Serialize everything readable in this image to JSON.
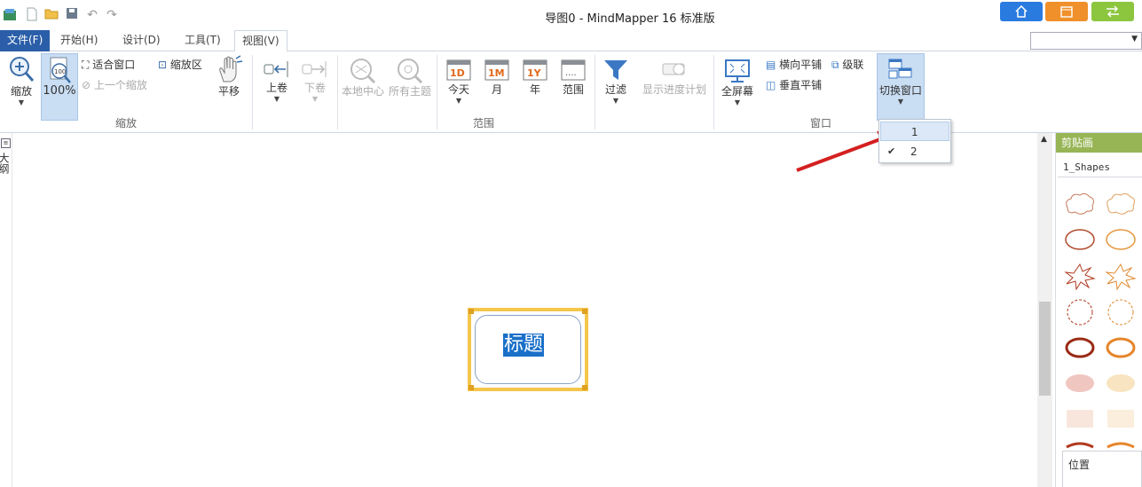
{
  "window": {
    "title": "导图0 - MindMapper 16 标准版"
  },
  "colors": {
    "win_home": "#2a7be0",
    "win_cal": "#f0902a",
    "win_swap": "#8cc63f",
    "accent": "#2a5ea8",
    "selection": "#1a70c9",
    "topic_border": "#f5c64a",
    "panel_header": "#97b555"
  },
  "quick_access": [
    "app-icon",
    "new-icon",
    "open-icon",
    "save-icon",
    "undo-icon",
    "redo-icon"
  ],
  "menu": {
    "tabs": [
      {
        "label": "文件(F)"
      },
      {
        "label": "开始(H)"
      },
      {
        "label": "设计(D)"
      },
      {
        "label": "工具(T)"
      },
      {
        "label": "视图(V)"
      }
    ]
  },
  "ribbon": {
    "zoom": {
      "label": "缩放",
      "percent": "100%",
      "fit_window": "适合窗口",
      "zoom_area": "缩放区",
      "prev_zoom": "上一个缩放",
      "pan": "平移",
      "group": "缩放"
    },
    "scroll": {
      "up": "上卷",
      "down": "下卷",
      "local_center": "本地中心",
      "all_topics": "所有主题"
    },
    "range": {
      "today": "今天",
      "month": "月",
      "year": "年",
      "range": "范围",
      "filter": "过滤",
      "show_progress": "显示进度计划",
      "group": "范围",
      "today_icon": "1D",
      "month_icon": "1M",
      "year_icon": "1Y"
    },
    "window": {
      "fullscreen": "全屏幕",
      "tile_h": "横向平铺",
      "tile_v": "垂直平铺",
      "cascade": "级联",
      "switch": "切换窗口",
      "group": "窗口"
    }
  },
  "dropdown": {
    "items": [
      {
        "label": "1",
        "checked": false
      },
      {
        "label": "2",
        "checked": true
      }
    ]
  },
  "sidebar": {
    "label": "大纲"
  },
  "topic": {
    "text": "标题"
  },
  "panel": {
    "header": "剪贴画",
    "selection": "1_Shapes",
    "position_label": "位置"
  }
}
